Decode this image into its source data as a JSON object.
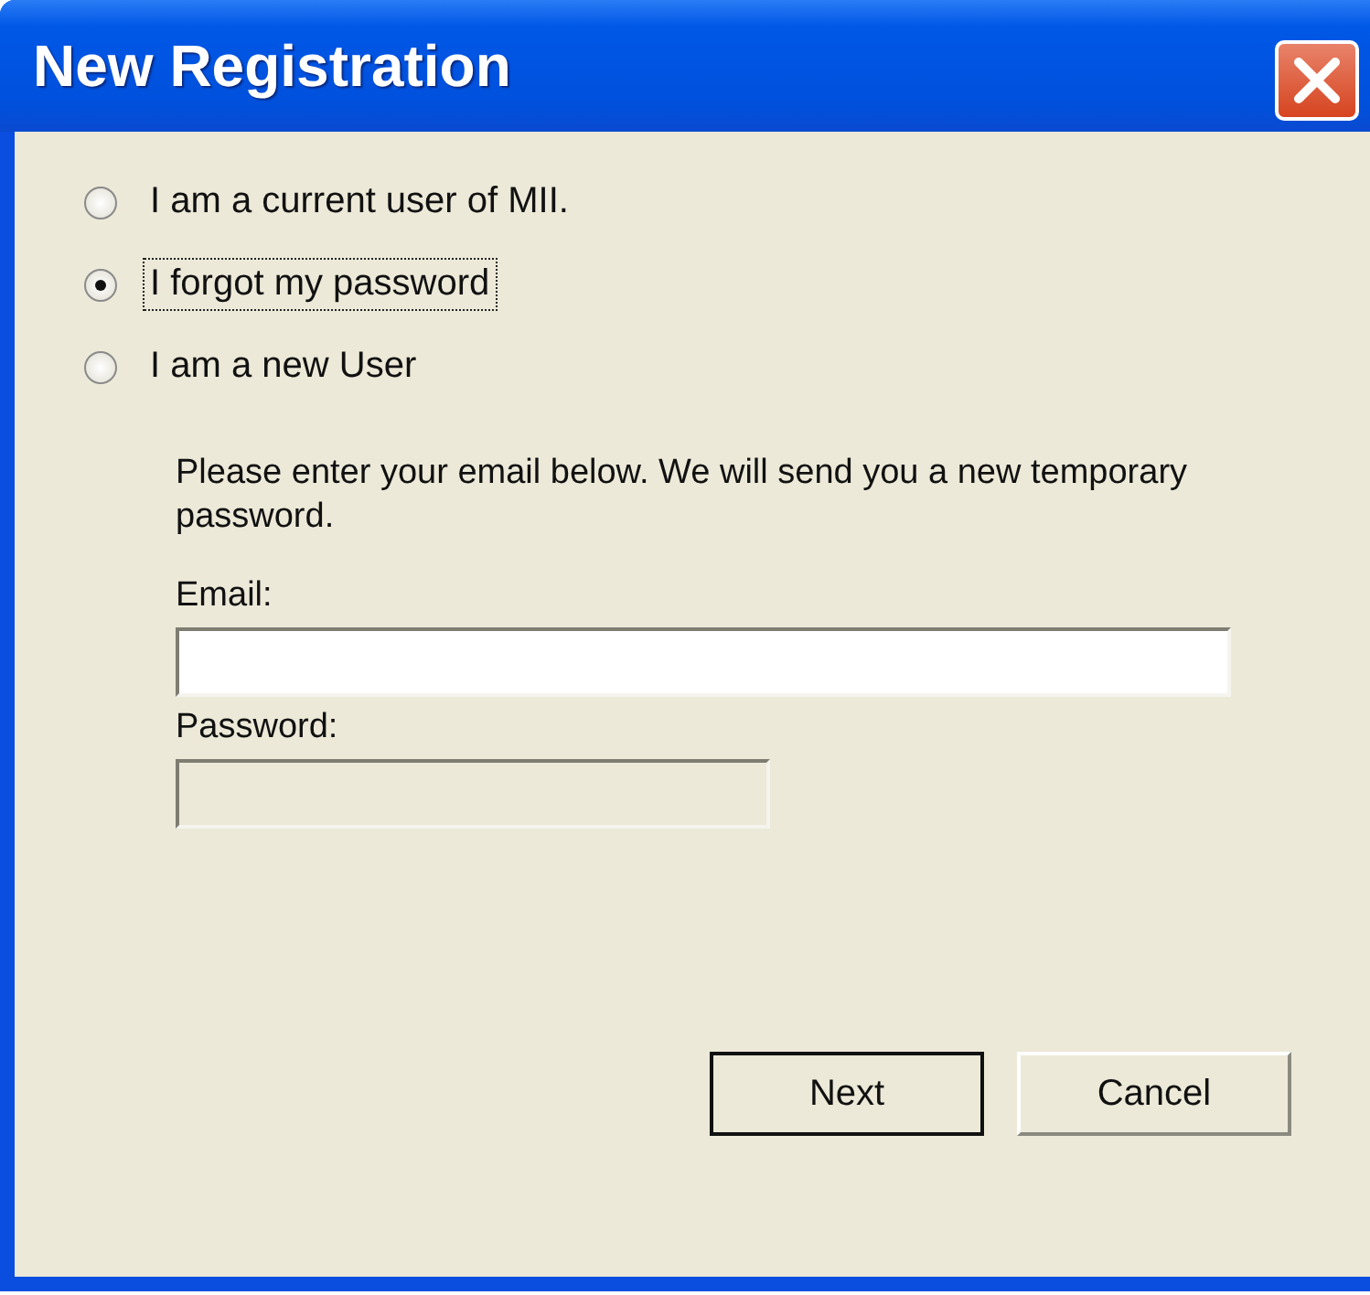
{
  "window": {
    "title": "New Registration"
  },
  "options": [
    {
      "label": "I am a current user of MII.",
      "selected": false,
      "focused": false
    },
    {
      "label": "I forgot my password",
      "selected": true,
      "focused": true
    },
    {
      "label": "I am a new User",
      "selected": false,
      "focused": false
    }
  ],
  "message": "Please enter your email below. We will send you a new temporary password.",
  "fields": [
    {
      "label": "Email:",
      "disabled": false
    },
    {
      "label": "Password:",
      "disabled": true
    }
  ],
  "buttons": [
    {
      "label": "Next",
      "default": true
    },
    {
      "label": "Cancel",
      "default": false
    }
  ]
}
